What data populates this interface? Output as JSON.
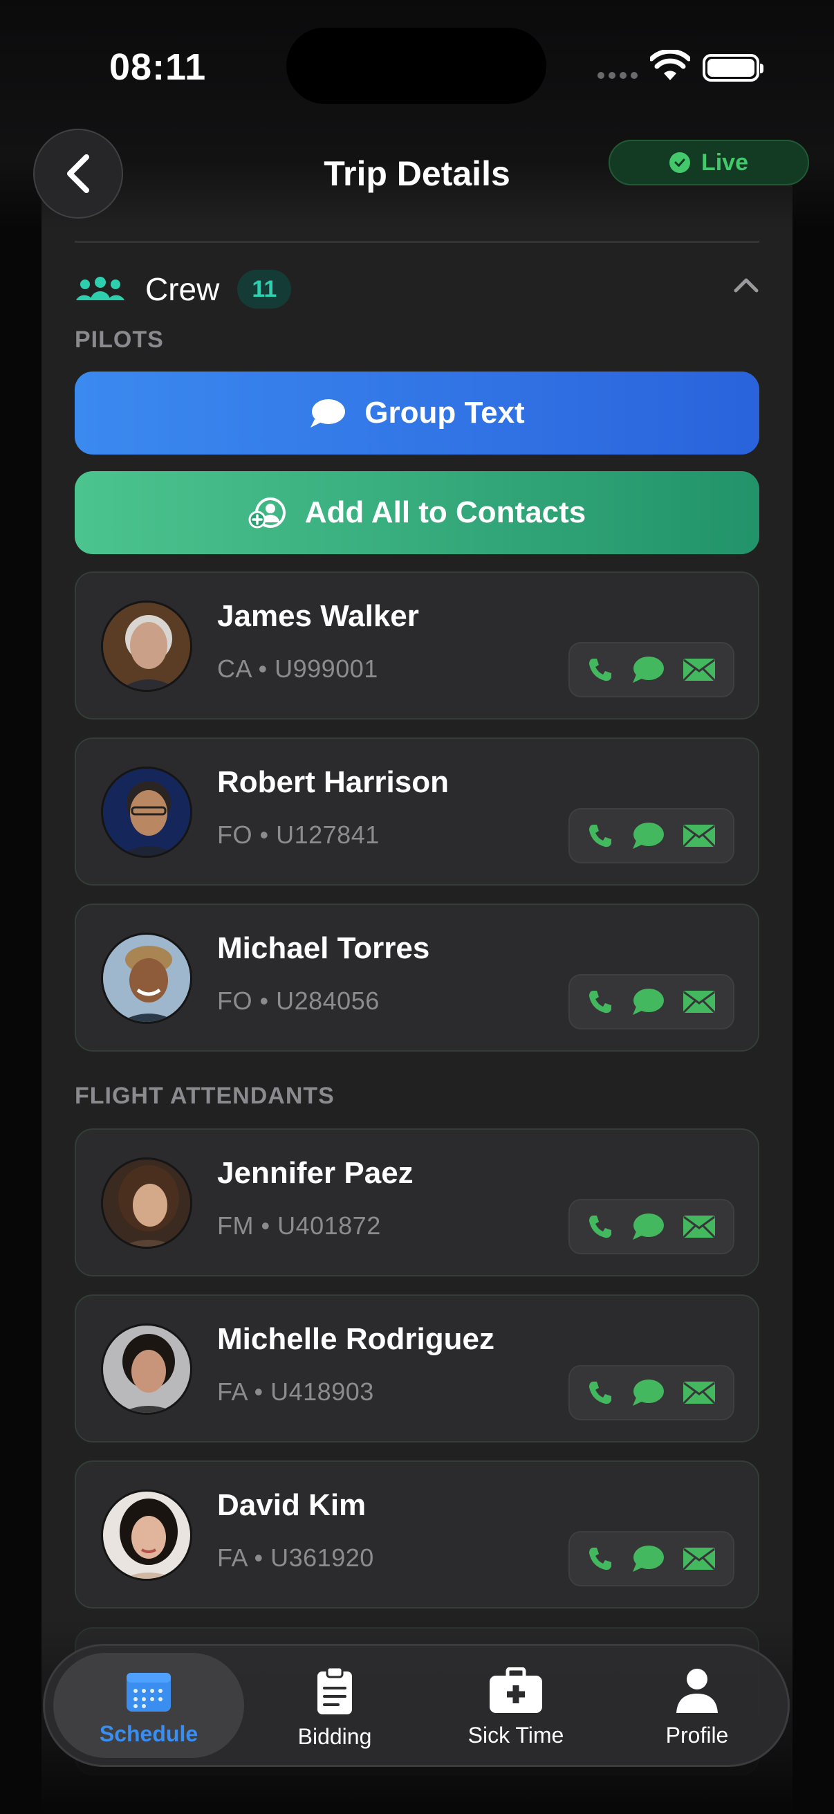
{
  "status_bar": {
    "time": "08:11"
  },
  "nav": {
    "title": "Trip Details",
    "live_label": "Live"
  },
  "crew": {
    "label": "Crew",
    "count": "11",
    "pilots_heading": "PILOTS",
    "group_text_label": "Group Text",
    "add_contacts_label": "Add All to Contacts",
    "attendants_heading": "FLIGHT ATTENDANTS",
    "pilots": [
      {
        "name": "James Walker",
        "role": "CA",
        "id": "U999001"
      },
      {
        "name": "Robert Harrison",
        "role": "FO",
        "id": "U127841"
      },
      {
        "name": "Michael Torres",
        "role": "FO",
        "id": "U284056"
      }
    ],
    "attendants": [
      {
        "name": "Jennifer Paez",
        "role": "FM",
        "id": "U401872"
      },
      {
        "name": "Michelle Rodriguez",
        "role": "FA",
        "id": "U418903"
      },
      {
        "name": "David Kim",
        "role": "FA",
        "id": "U361920"
      }
    ]
  },
  "tabbar": {
    "items": [
      {
        "label": "Schedule",
        "icon": "calendar-icon",
        "selected": true
      },
      {
        "label": "Bidding",
        "icon": "clipboard-icon"
      },
      {
        "label": "Sick Time",
        "icon": "medkit-icon"
      },
      {
        "label": "Profile",
        "icon": "person-icon"
      }
    ]
  },
  "colors": {
    "accent_blue": "#3a86ef",
    "accent_green": "#3fb97f",
    "live_green": "#43c86b",
    "teal": "#2dcfae",
    "action_green": "#43b85e"
  }
}
